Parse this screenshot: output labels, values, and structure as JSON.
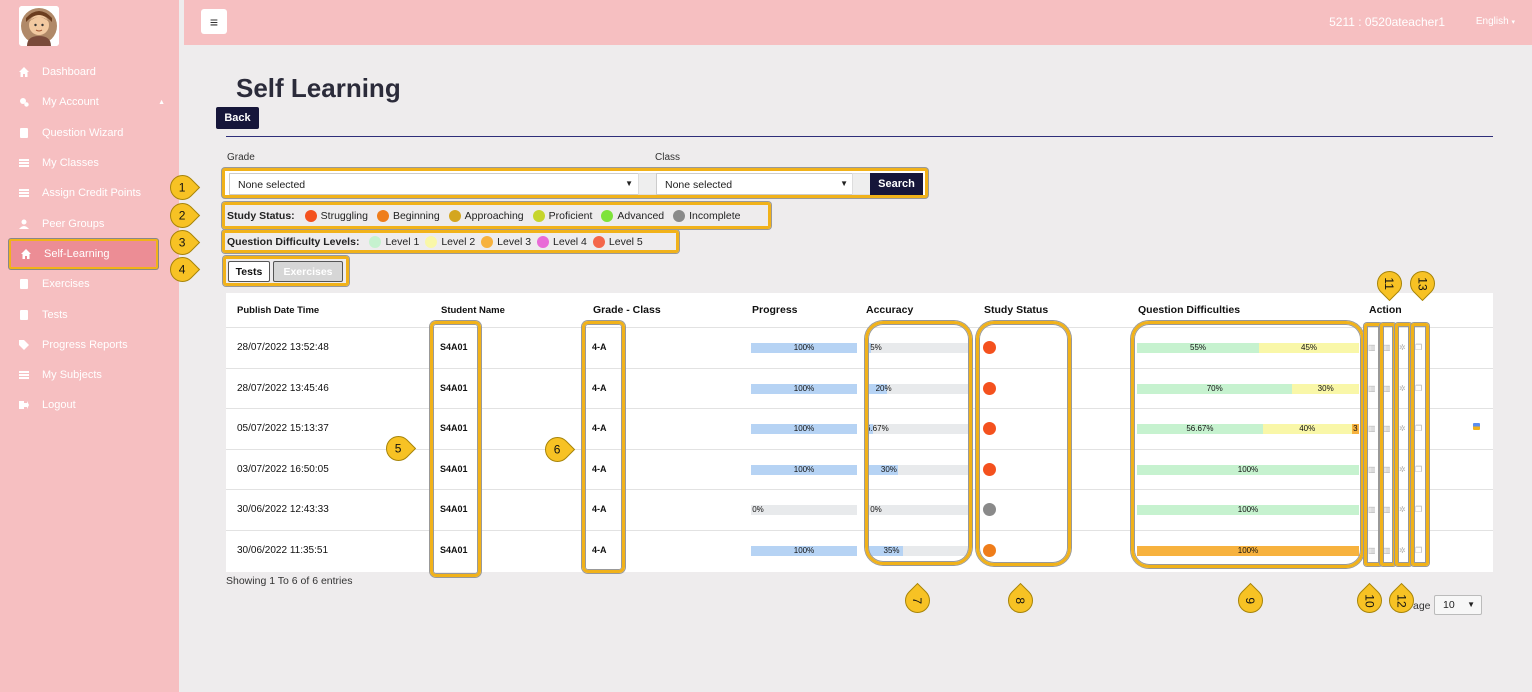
{
  "sidebar": {
    "items": [
      {
        "label": "Dashboard",
        "icon": "home-icon"
      },
      {
        "label": "My Account",
        "icon": "cogs-icon"
      },
      {
        "label": "Question Wizard",
        "icon": "book-icon"
      },
      {
        "label": "My Classes",
        "icon": "list-icon"
      },
      {
        "label": "Assign Credit Points",
        "icon": "list-icon"
      },
      {
        "label": "Peer Groups",
        "icon": "user-icon"
      },
      {
        "label": "Self-Learning",
        "icon": "home-icon"
      },
      {
        "label": "Exercises",
        "icon": "book-icon"
      },
      {
        "label": "Tests",
        "icon": "book-icon"
      },
      {
        "label": "Progress Reports",
        "icon": "tags-icon"
      },
      {
        "label": "My Subjects",
        "icon": "list-icon"
      },
      {
        "label": "Logout",
        "icon": "logout-icon"
      }
    ]
  },
  "header": {
    "menu_icon": "≡",
    "user": "5211 : 0520ateacher1",
    "language": "English"
  },
  "page": {
    "title": "Self Learning",
    "back": "Back"
  },
  "filters": {
    "grade_label": "Grade",
    "class_label": "Class",
    "grade_value": "None selected",
    "class_value": "None selected",
    "search": "Search"
  },
  "study_status": {
    "title": "Study Status:",
    "items": [
      {
        "label": "Struggling",
        "color": "#f4511e"
      },
      {
        "label": "Beginning",
        "color": "#ef7d1a"
      },
      {
        "label": "Approaching",
        "color": "#d4a61f"
      },
      {
        "label": "Proficient",
        "color": "#c6d52c"
      },
      {
        "label": "Advanced",
        "color": "#7ee33a"
      },
      {
        "label": "Incomplete",
        "color": "#8a8a8a"
      }
    ]
  },
  "difficulty": {
    "title": "Question Difficulty Levels:",
    "items": [
      {
        "label": "Level 1",
        "color": "#c6f2cf"
      },
      {
        "label": "Level 2",
        "color": "#f9f7a8"
      },
      {
        "label": "Level 3",
        "color": "#f7b23e"
      },
      {
        "label": "Level 4",
        "color": "#e96ad7"
      },
      {
        "label": "Level 5",
        "color": "#f4664a"
      }
    ]
  },
  "tabs": {
    "tests": "Tests",
    "exercises": "Exercises"
  },
  "table": {
    "headers": {
      "date": "Publish Date Time",
      "student": "Student Name",
      "grade_class": "Grade - Class",
      "progress": "Progress",
      "accuracy": "Accuracy",
      "study_status": "Study Status",
      "qd": "Question Difficulties",
      "action": "Action"
    },
    "rows": [
      {
        "date": "28/07/2022 13:52:48",
        "student": "S4A01",
        "grade_class": "4-A",
        "progress": 100,
        "progress_text": "100%",
        "accuracy": 5,
        "accuracy_text": "5%",
        "status_color": "#f4511e",
        "qd": [
          {
            "pct": 55,
            "text": "55%",
            "color": "#c6f2cf"
          },
          {
            "pct": 45,
            "text": "45%",
            "color": "#f9f7a8"
          }
        ]
      },
      {
        "date": "28/07/2022 13:45:46",
        "student": "S4A01",
        "grade_class": "4-A",
        "progress": 100,
        "progress_text": "100%",
        "accuracy": 20,
        "accuracy_text": "20%",
        "status_color": "#f4511e",
        "qd": [
          {
            "pct": 70,
            "text": "70%",
            "color": "#c6f2cf"
          },
          {
            "pct": 30,
            "text": "30%",
            "color": "#f9f7a8"
          }
        ]
      },
      {
        "date": "05/07/2022 15:13:37",
        "student": "S4A01",
        "grade_class": "4-A",
        "progress": 100,
        "progress_text": "100%",
        "accuracy": 6.67,
        "accuracy_text": "6.67%",
        "status_color": "#f4511e",
        "qd": [
          {
            "pct": 56.67,
            "text": "56.67%",
            "color": "#c6f2cf"
          },
          {
            "pct": 40,
            "text": "40%",
            "color": "#f9f7a8"
          },
          {
            "pct": 3.33,
            "text": "3",
            "color": "#f7b23e"
          }
        ]
      },
      {
        "date": "03/07/2022 16:50:05",
        "student": "S4A01",
        "grade_class": "4-A",
        "progress": 100,
        "progress_text": "100%",
        "accuracy": 30,
        "accuracy_text": "30%",
        "status_color": "#f4511e",
        "qd": [
          {
            "pct": 100,
            "text": "100%",
            "color": "#c6f2cf"
          }
        ]
      },
      {
        "date": "30/06/2022 12:43:33",
        "student": "S4A01",
        "grade_class": "4-A",
        "progress": 0,
        "progress_text": "0%",
        "accuracy": 0,
        "accuracy_text": "0%",
        "status_color": "#8a8a8a",
        "qd": [
          {
            "pct": 100,
            "text": "100%",
            "color": "#c6f2cf"
          }
        ]
      },
      {
        "date": "30/06/2022 11:35:51",
        "student": "S4A01",
        "grade_class": "4-A",
        "progress": 100,
        "progress_text": "100%",
        "accuracy": 35,
        "accuracy_text": "35%",
        "status_color": "#ef7d1a",
        "qd": [
          {
            "pct": 100,
            "text": "100%",
            "color": "#f7b23e"
          }
        ]
      }
    ],
    "action_icons": [
      "bar-chart-icon",
      "bar-chart-icon",
      "gear-icon",
      "copy-icon"
    ]
  },
  "footer": {
    "info": "Showing 1 To 6 of 6 entries",
    "page_label": "age",
    "page_size": "10"
  },
  "callouts": [
    "1",
    "2",
    "3",
    "4",
    "5",
    "6",
    "7",
    "8",
    "9",
    "10",
    "11",
    "12",
    "13"
  ]
}
